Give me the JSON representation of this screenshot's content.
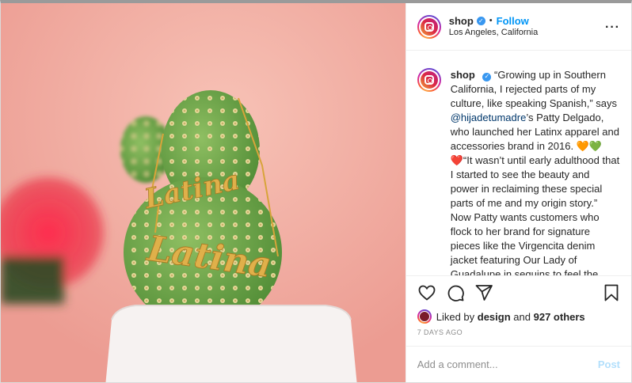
{
  "header": {
    "username": "shop",
    "separator": "•",
    "follow_label": "Follow",
    "location": "Los Angeles, California",
    "more_label": "···"
  },
  "caption": {
    "username": "shop",
    "text_part1": "“Growing up in Southern California, I rejected parts of my culture, like speaking Spanish,” says ",
    "mention": "@hijadetumadre",
    "text_part2": "’s Patty Delgado, who launched her Latinx apparel and accessories brand in 2016. 🧡💚❤️“It wasn’t until early adulthood that I started to see the beauty and power in reclaiming these special parts of me and my origin story.” Now Patty wants customers who flock to her brand for signature pieces like the Virgencita denim jacket featuring Our Lady of Guadalupe in sequins to feel the same sense of pride. “To be Latinx means that you’re constantly juggling two or more cultures,” she says. “And there’s no right one [or] dominant one. I love"
  },
  "icons": {
    "like": "heart-icon",
    "comment": "comment-icon",
    "share": "share-icon",
    "save": "bookmark-icon",
    "verified": "verified-badge-icon"
  },
  "likes": {
    "prefix": "Liked by",
    "user": "design",
    "joiner": "and",
    "count_text": "927 others"
  },
  "timestamp": "7 DAYS AGO",
  "composer": {
    "placeholder": "Add a comment...",
    "post_label": "Post"
  },
  "photo": {
    "necklace_text": "Latina"
  },
  "colors": {
    "accent": "#0095f6",
    "post_disabled": "#b2dffc",
    "verified": "#3897f0"
  }
}
